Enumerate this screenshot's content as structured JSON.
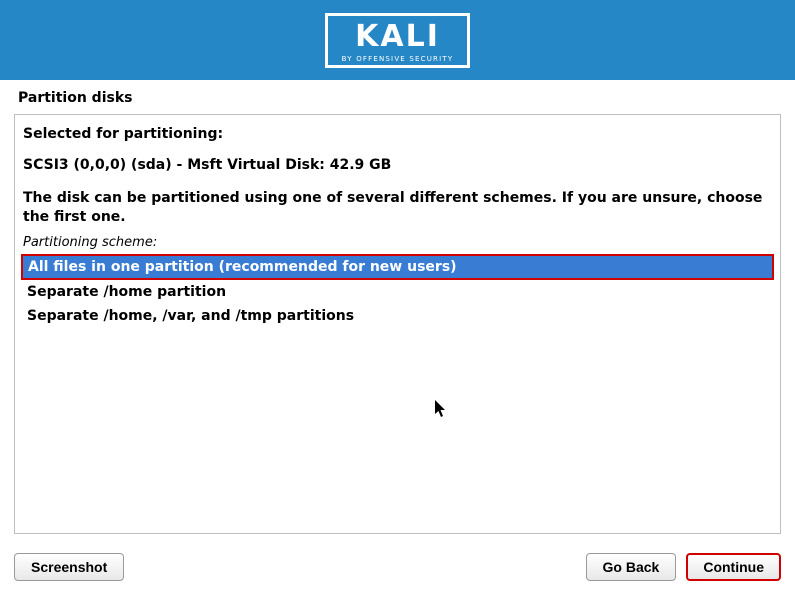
{
  "logo": {
    "name": "KALI",
    "subtitle": "BY OFFENSIVE SECURITY"
  },
  "page_title": "Partition disks",
  "panel": {
    "selected_label": "Selected for partitioning:",
    "disk_info": "SCSI3 (0,0,0) (sda) - Msft Virtual Disk: 42.9 GB",
    "instruction": "The disk can be partitioned using one of several different schemes. If you are unsure, choose the first one.",
    "scheme_label": "Partitioning scheme:"
  },
  "options": [
    {
      "label": "All files in one partition (recommended for new users)",
      "selected": true
    },
    {
      "label": "Separate /home partition",
      "selected": false
    },
    {
      "label": "Separate /home, /var, and /tmp partitions",
      "selected": false
    }
  ],
  "buttons": {
    "screenshot": "Screenshot",
    "go_back": "Go Back",
    "continue": "Continue"
  }
}
